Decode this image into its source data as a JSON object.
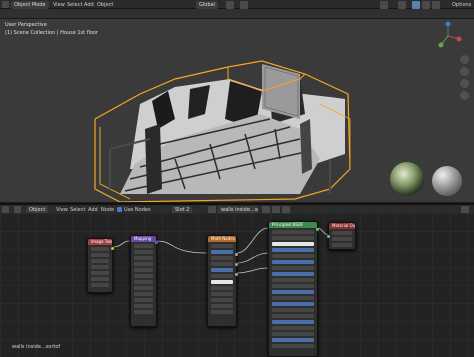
{
  "top_bar": {
    "mode": "Object Mode",
    "menu": [
      "View",
      "Select",
      "Add",
      "Object"
    ],
    "transform": "Global",
    "options": "Options"
  },
  "viewport": {
    "view_name": "User Perspective",
    "collection": "(1) Scene Collection | House 1st floor"
  },
  "node_header": {
    "editor_type": "Object",
    "menu": [
      "View",
      "Select",
      "Add",
      "Node"
    ],
    "use_nodes": "Use Nodes",
    "slot": "Slot 2",
    "material": "walls inside...sortof"
  },
  "nodes": {
    "n1": "Image Texture",
    "n2": "Mapping",
    "n3": "Math Nodes",
    "n4": "Principled BSDF",
    "n5": "Material Output"
  },
  "status": {
    "material_label": "walls inside...sortof"
  },
  "colors": {
    "outline": "#f5a623",
    "node_red": "#a04040",
    "node_purple": "#6a4aa6",
    "node_orange": "#b06a2a",
    "node_green": "#3d8a4c",
    "node_dark_red": "#8c2e2e"
  }
}
